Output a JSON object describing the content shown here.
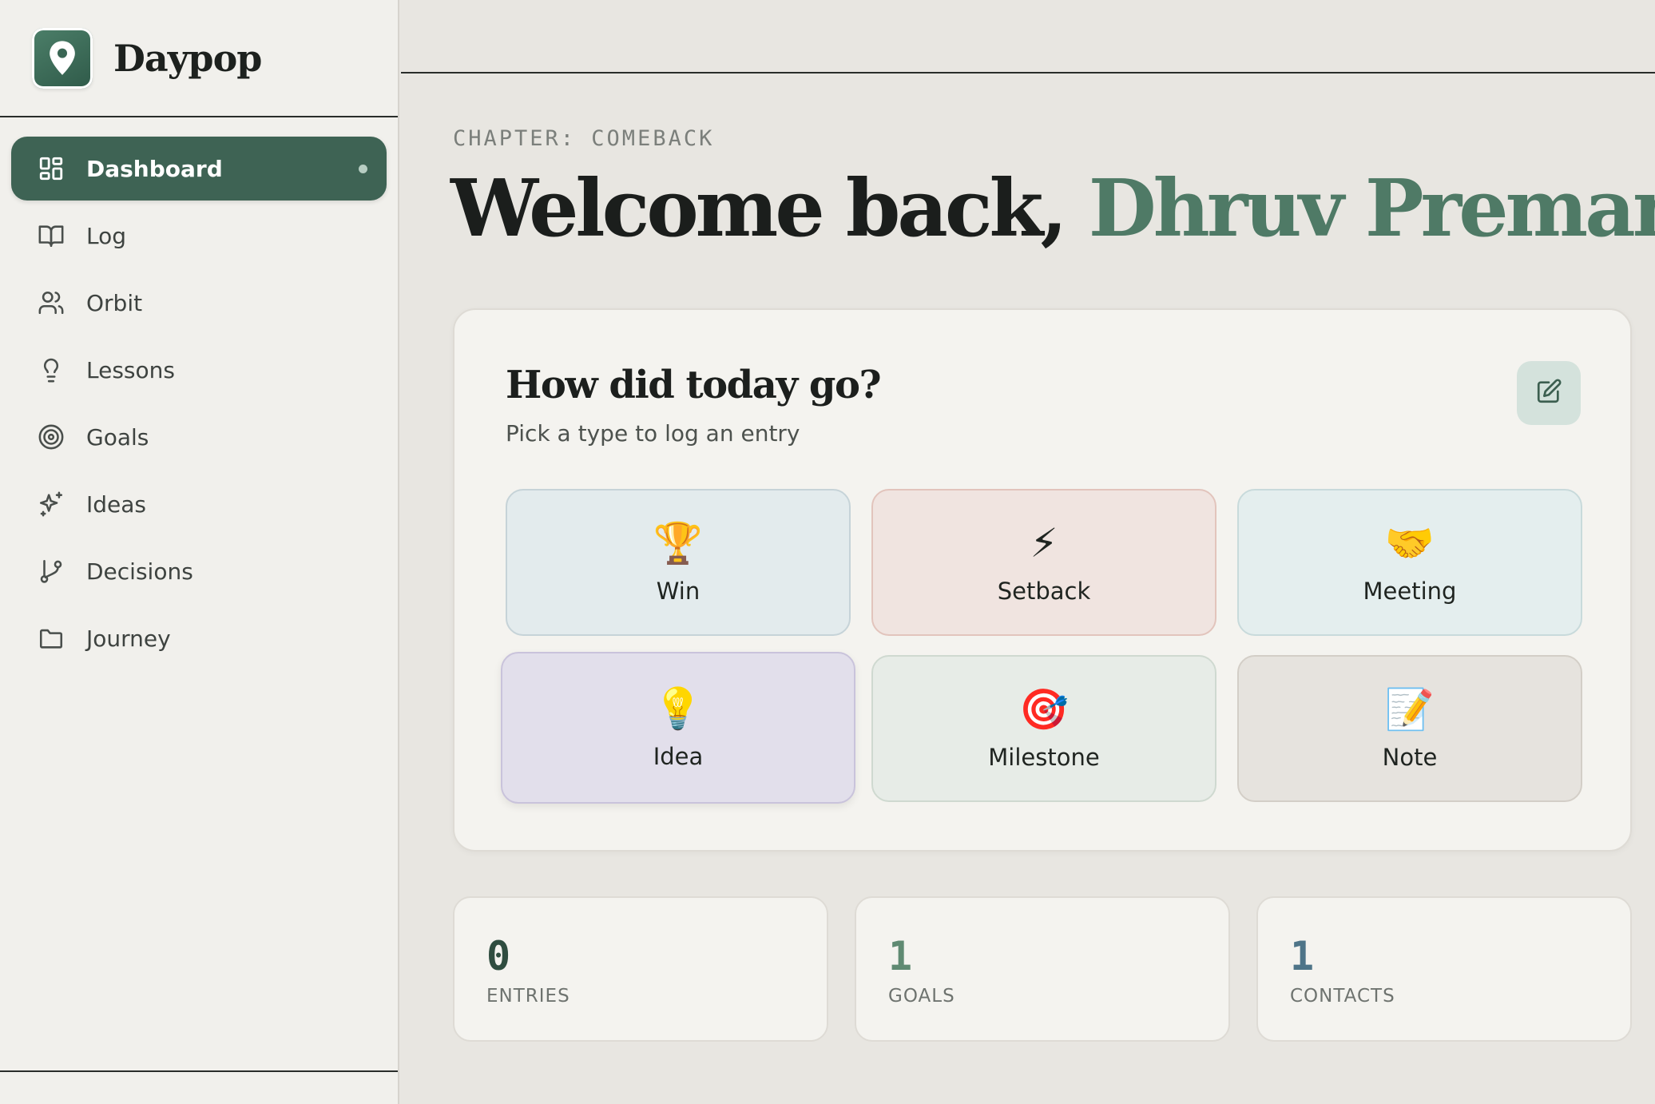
{
  "brand": {
    "name": "Daypop",
    "logo_icon": "map-pin-icon"
  },
  "sidebar": {
    "items": [
      {
        "label": "Dashboard",
        "icon": "dashboard-grid-icon",
        "active": true
      },
      {
        "label": "Log",
        "icon": "book-open-icon"
      },
      {
        "label": "Orbit",
        "icon": "users-icon"
      },
      {
        "label": "Lessons",
        "icon": "lightbulb-icon"
      },
      {
        "label": "Goals",
        "icon": "target-icon"
      },
      {
        "label": "Ideas",
        "icon": "sparkles-icon"
      },
      {
        "label": "Decisions",
        "icon": "git-branch-icon"
      },
      {
        "label": "Journey",
        "icon": "folder-icon"
      }
    ]
  },
  "header": {
    "chapter": "CHAPTER: COMEBACK",
    "welcome_prefix": "Welcome back, ",
    "user_name": "Dhruv Premani"
  },
  "log_card": {
    "title": "How did today go?",
    "subtitle": "Pick a type to log an entry",
    "edit_icon": "edit-icon",
    "types": [
      {
        "label": "Win",
        "emoji": "🏆"
      },
      {
        "label": "Setback",
        "emoji": "⚡"
      },
      {
        "label": "Meeting",
        "emoji": "🤝"
      },
      {
        "label": "Idea",
        "emoji": "💡"
      },
      {
        "label": "Milestone",
        "emoji": "🎯"
      },
      {
        "label": "Note",
        "emoji": "📝"
      }
    ]
  },
  "stats": [
    {
      "value": "0",
      "label": "ENTRIES"
    },
    {
      "value": "1",
      "label": "GOALS"
    },
    {
      "value": "1",
      "label": "CONTACTS"
    }
  ],
  "colors": {
    "accent": "#3e6354",
    "name_green": "#4f7a66",
    "background": "#e8e6e1",
    "sidebar_bg": "#f1f0ec"
  }
}
